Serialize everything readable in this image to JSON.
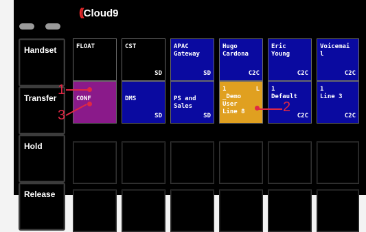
{
  "brand": {
    "name": "Cloud9",
    "accent": "#e8282b"
  },
  "side_buttons": [
    {
      "label": "Handset"
    },
    {
      "label": "Transfer"
    },
    {
      "label": "Hold"
    },
    {
      "label": "Release"
    }
  ],
  "keys_row1": [
    {
      "label": "FLOAT",
      "tag": "",
      "color": "black"
    },
    {
      "label": "CST",
      "tag": "SD",
      "color": "black"
    },
    {
      "label": "APAC\nGateway",
      "tag": "SD",
      "color": "blue"
    },
    {
      "label": "Hugo\nCardona",
      "tag": "C2C",
      "color": "blue"
    },
    {
      "label": "Eric\nYoung",
      "tag": "C2C",
      "color": "blue"
    },
    {
      "label": "Voicemai\nl",
      "tag": "C2C",
      "color": "blue"
    }
  ],
  "keys_row2": [
    {
      "label": "CONF",
      "tag": "",
      "color": "purple"
    },
    {
      "label": "DMS",
      "tag": "SD",
      "color": "blue"
    },
    {
      "label": "PS and\nSales",
      "tag": "SD",
      "color": "blue"
    },
    {
      "label": "1\n_Demo\nUser\nLine 8",
      "corner": "L",
      "tag": "",
      "color": "gold"
    },
    {
      "label": "1\nDefault",
      "tag": "C2C",
      "color": "blue"
    },
    {
      "label": "1\nLine 3",
      "tag": "C2C",
      "color": "blue"
    }
  ],
  "callouts": [
    "1",
    "2",
    "3"
  ],
  "colors": {
    "blue": "#0a0aa0",
    "purple": "#8a1a8a",
    "gold": "#e0a020",
    "callout": "#e02844"
  }
}
